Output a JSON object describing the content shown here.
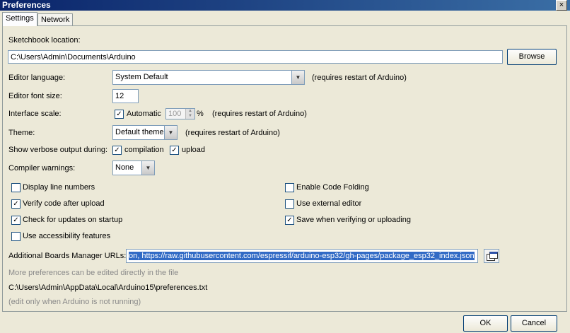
{
  "window": {
    "title": "Preferences",
    "close_glyph": "×"
  },
  "tabs": [
    {
      "label": "Settings"
    },
    {
      "label": "Network"
    }
  ],
  "sketchbook": {
    "label": "Sketchbook location:",
    "value": "C:\\Users\\Admin\\Documents\\Arduino",
    "browse_label": "Browse"
  },
  "language": {
    "label": "Editor language:",
    "value": "System Default",
    "note": "(requires restart of Arduino)"
  },
  "font_size": {
    "label": "Editor font size:",
    "value": "12"
  },
  "interface_scale": {
    "label": "Interface scale:",
    "automatic_label": "Automatic",
    "automatic_checked": true,
    "value": "100",
    "unit": "%",
    "note": "(requires restart of Arduino)"
  },
  "theme": {
    "label": "Theme:",
    "value": "Default theme",
    "note": "(requires restart of Arduino)"
  },
  "verbose": {
    "label": "Show verbose output during:",
    "compilation_label": "compilation",
    "upload_label": "upload"
  },
  "warnings": {
    "label": "Compiler warnings:",
    "value": "None"
  },
  "options": {
    "display_line_numbers": "Display line numbers",
    "verify_after_upload": "Verify code after upload",
    "check_updates": "Check for updates on startup",
    "accessibility": "Use accessibility features",
    "code_folding": "Enable Code Folding",
    "external_editor": "Use external editor",
    "save_when_verifying": "Save when verifying or uploading"
  },
  "boards_urls": {
    "label": "Additional Boards Manager URLs:",
    "value": "on, https://raw.githubusercontent.com/espressif/arduino-esp32/gh-pages/package_esp32_index.json"
  },
  "footer_info": {
    "more_prefs": "More preferences can be edited directly in the file",
    "prefs_path": "C:\\Users\\Admin\\AppData\\Local\\Arduino15\\preferences.txt",
    "edit_note": "(edit only when Arduino is not running)"
  },
  "buttons": {
    "ok": "OK",
    "cancel": "Cancel"
  },
  "check_glyph": "✓",
  "icons": {
    "dropdown": "▼",
    "spin_up": "▲",
    "spin_down": "▼"
  }
}
